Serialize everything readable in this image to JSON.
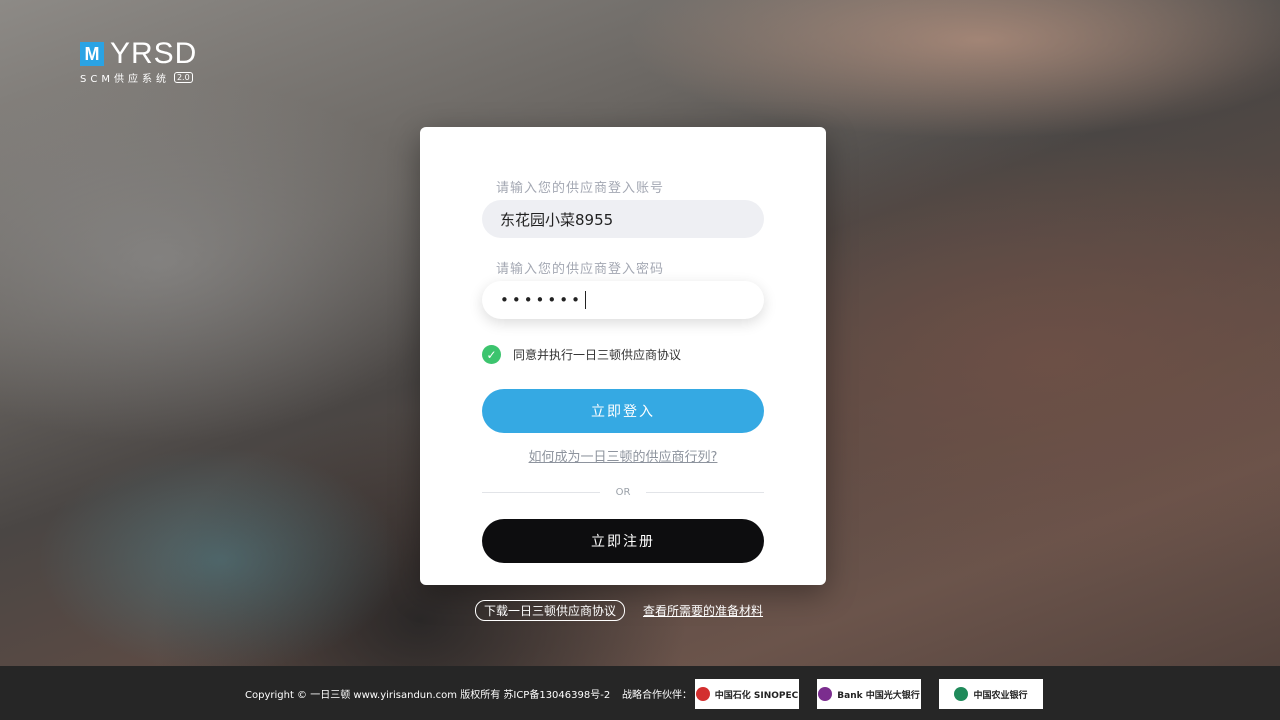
{
  "logo": {
    "mark": "M",
    "name": "YRSD",
    "subtitle": "SCM供应系统",
    "version": "2.0"
  },
  "form": {
    "account_label": "请输入您的供应商登入账号",
    "account_value": "东花园小菜8955",
    "password_label": "请输入您的供应商登入密码",
    "password_value": "•••••••",
    "agree_text": "同意并执行一日三顿供应商协议",
    "login_button": "立即登入",
    "supplier_link": "如何成为一日三顿的供应商行列?",
    "or_text": "OR",
    "register_button": "立即注册"
  },
  "bottom_links": {
    "download": "下载一日三顿供应商协议",
    "materials": "查看所需要的准备材料"
  },
  "footer": {
    "copyright": "Copyright © 一日三顿 www.yirisandun.com 版权所有   苏ICP备13046398号-2",
    "partners_label": "战略合作伙伴：",
    "partners": [
      {
        "name": "中国石化 SINOPEC",
        "color": "#d32f2f"
      },
      {
        "name": "Bank 中国光大银行",
        "color": "#7b2d8e"
      },
      {
        "name": "中国农业银行",
        "color": "#1f8a5a"
      }
    ]
  },
  "colors": {
    "accent": "#35a9e3",
    "check": "#3cc46e",
    "dark_button": "#0d0d0f"
  }
}
